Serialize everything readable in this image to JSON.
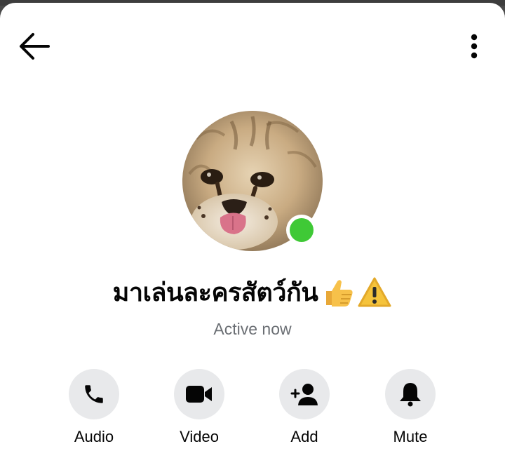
{
  "header": {
    "back_icon": "arrow-left-icon",
    "more_icon": "more-vertical-icon"
  },
  "profile": {
    "name": "มาเล่นละครสัตว์กัน",
    "name_emojis": [
      "thumbs-up-icon",
      "warning-icon"
    ],
    "status": "Active now",
    "presence": "online",
    "presence_color": "#3fc936"
  },
  "actions": [
    {
      "label": "Audio",
      "icon": "phone-icon"
    },
    {
      "label": "Video",
      "icon": "video-camera-icon"
    },
    {
      "label": "Add",
      "icon": "add-person-icon"
    },
    {
      "label": "Mute",
      "icon": "bell-icon"
    }
  ]
}
